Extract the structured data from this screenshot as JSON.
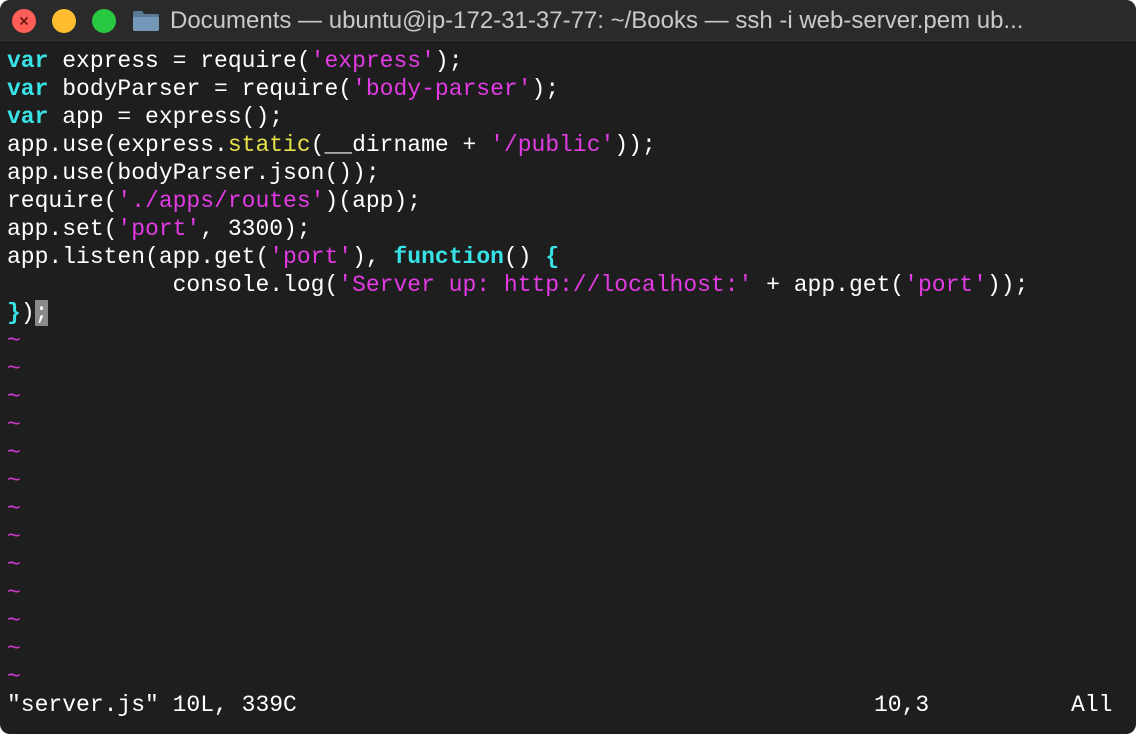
{
  "window": {
    "title": "Documents — ubuntu@ip-172-31-37-77: ~/Books — ssh -i web-server.pem ub...",
    "icon": "folder-icon",
    "controls": [
      "close-button",
      "minimize-button",
      "zoom-button"
    ]
  },
  "editor": {
    "lines": [
      {
        "t1": "var",
        "t2": " express = require(",
        "t3": "'express'",
        "t4": ");"
      },
      {
        "t1": "var",
        "t2": " bodyParser = require(",
        "t3": "'body-parser'",
        "t4": ");"
      },
      {
        "t1": "var",
        "t2": " app = express();"
      },
      {
        "t1": "app.use(express.",
        "t2": "static",
        "t3": "(__dirname + ",
        "t4": "'/public'",
        "t5": "));"
      },
      {
        "t1": "app.use(bodyParser.json());"
      },
      {
        "t1": "require(",
        "t2": "'./apps/routes'",
        "t3": ")(app);"
      },
      {
        "t1": "app.set(",
        "t2": "'port'",
        "t3": ", 3300);"
      },
      {
        "t1": "app.listen(app.get(",
        "t2": "'port'",
        "t3": "), ",
        "t4": "function",
        "t5": "() ",
        "t6": "{"
      },
      {
        "t1": "            console.log(",
        "t2": "'Server up: http://localhost:'",
        "t3": " + app.get(",
        "t4": "'port'",
        "t5": "));"
      },
      {
        "t1": "}",
        "t2": ")",
        "t3": ";"
      }
    ],
    "tilde": "~",
    "empty_line_count": 13
  },
  "status_bar": {
    "file_info": "\"server.js\" 10L, 339C",
    "cursor_position": "10,3",
    "scroll_position": "All"
  },
  "colors": {
    "background": "#1e1e1e",
    "keyword": "#37e3e6",
    "string": "#e23be3",
    "builtin": "#e6e24a",
    "tilde": "#d63ad6"
  }
}
